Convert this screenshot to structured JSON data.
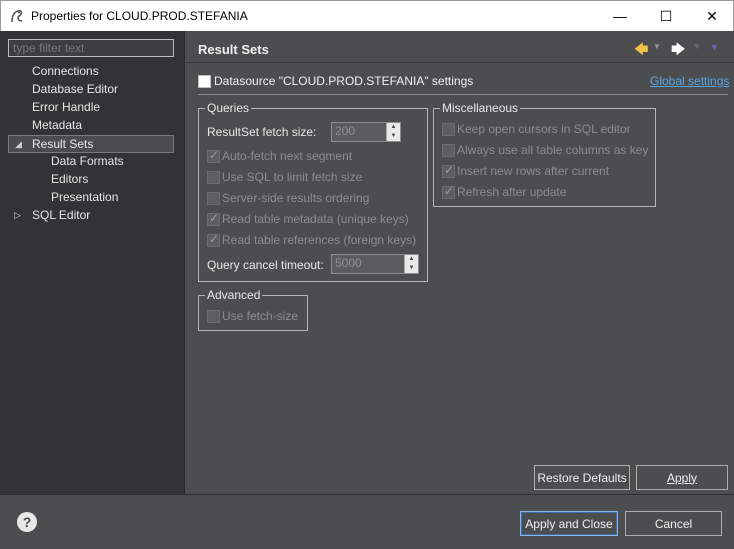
{
  "window": {
    "title": "Properties for CLOUD.PROD.STEFANIA",
    "minimize": "—",
    "maximize": "☐",
    "close": "✕"
  },
  "filter": {
    "placeholder": "type filter text"
  },
  "tree": {
    "items": [
      {
        "label": "Connections",
        "level": 0
      },
      {
        "label": "Database Editor",
        "level": 0
      },
      {
        "label": "Error Handle",
        "level": 0
      },
      {
        "label": "Metadata",
        "level": 0
      },
      {
        "label": "Result Sets",
        "level": 0,
        "expanded": true,
        "selected": true
      },
      {
        "label": "Data Formats",
        "level": 1
      },
      {
        "label": "Editors",
        "level": 1
      },
      {
        "label": "Presentation",
        "level": 1
      },
      {
        "label": "SQL Editor",
        "level": 0,
        "collapsed": true
      }
    ]
  },
  "page": {
    "title": "Result Sets",
    "datasource_label": "Datasource \"CLOUD.PROD.STEFANIA\" settings",
    "global_link": "Global settings",
    "queries": {
      "legend": "Queries",
      "fetch_size_label": "ResultSet fetch size:",
      "fetch_size_value": "200",
      "auto_fetch": "Auto-fetch next segment",
      "use_sql_limit": "Use SQL to limit fetch size",
      "server_side_order": "Server-side results ordering",
      "read_metadata": "Read table metadata (unique keys)",
      "read_references": "Read table references (foreign keys)",
      "timeout_label": "Query cancel timeout:",
      "timeout_value": "5000"
    },
    "misc": {
      "legend": "Miscellaneous",
      "keep_cursors": "Keep open cursors in SQL editor",
      "all_columns_key": "Always use all table columns as key",
      "insert_after": "Insert new rows after current",
      "refresh_after": "Refresh after update"
    },
    "advanced": {
      "legend": "Advanced",
      "use_fetch_size": "Use fetch-size"
    },
    "restore_defaults": "Restore Defaults",
    "apply": "Apply"
  },
  "footer": {
    "help": "?",
    "apply_close": "Apply and Close",
    "cancel": "Cancel"
  },
  "colors": {
    "link": "#5aa7e6",
    "background": "#4b4d4f",
    "tree_bg": "#313335"
  }
}
